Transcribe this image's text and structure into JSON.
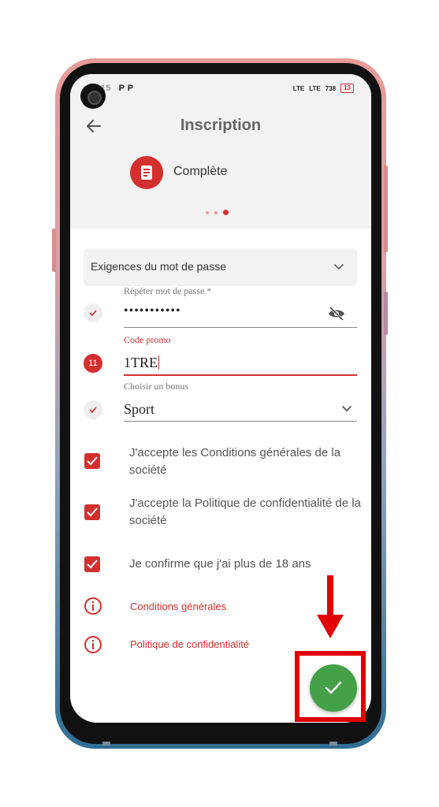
{
  "status_bar": {
    "time": "2:15",
    "notif_icons": "P P",
    "signal1": "LTE",
    "signal2": "LTE",
    "speed": "738",
    "battery": "13"
  },
  "header": {
    "title": "Inscription",
    "step_label": "Complète"
  },
  "password_requirements": {
    "label": "Exigences du mot de passe"
  },
  "fields": {
    "repeat_password": {
      "label": "Répéter mot de passe *",
      "value": "•••••••••••"
    },
    "promo_code": {
      "label": "Code promo",
      "value": "1TRE",
      "error_badge": "11"
    },
    "bonus": {
      "label": "Choisir un bonus",
      "value": "Sport"
    }
  },
  "checkboxes": [
    {
      "label": "J'accepte les Conditions générales de la société",
      "checked": true
    },
    {
      "label": "J'accepte la Politique de confidentialité de la société",
      "checked": true
    },
    {
      "label": "Je confirme que j'ai plus de 18 ans",
      "checked": true
    }
  ],
  "links": {
    "terms": "Conditions générales",
    "privacy": "Politique de confidentialité"
  },
  "colors": {
    "accent": "#d32f2f",
    "fab": "#43a047",
    "annotation": "#e00000"
  },
  "icons": [
    "back-arrow-icon",
    "document-icon",
    "chevron-down-icon",
    "check-icon",
    "eye-off-icon",
    "info-icon",
    "checkmark-icon"
  ]
}
